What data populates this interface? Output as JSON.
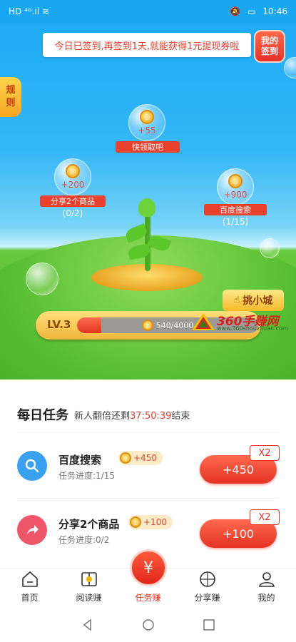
{
  "status_bar": {
    "left": "HD ⁴ᴳ.ıl ≋",
    "time": "10:46"
  },
  "hero": {
    "sign_banner": "今日已签到,再签到1天,就能获得1元提现券啦",
    "my_signin_line1": "我的",
    "my_signin_line2": "签到",
    "rules_line1": "规",
    "rules_line2": "则",
    "bubbles": [
      {
        "value": "+55",
        "label": "快领取吧",
        "progress": ""
      },
      {
        "value": "+200",
        "label": "分享2个商品",
        "progress": "(0/2)"
      },
      {
        "value": "+900",
        "label": "百度搜索",
        "progress": "(1/15)"
      }
    ],
    "mall_label": "挑小城",
    "watermark_title": "360手赚网",
    "watermark_url": "www.360shouzhuan.com"
  },
  "level": {
    "label": "LV.3",
    "current": 540,
    "max": 4000,
    "text": "540/4000"
  },
  "tasks": {
    "title": "每日任务",
    "subtitle_prefix": "新人翻倍还剩",
    "countdown": "37:50:39",
    "subtitle_suffix": "结束",
    "items": [
      {
        "name": "百度搜索",
        "reward": "+450",
        "progress": "任务进度:1/15",
        "button": "+450",
        "multiplier": "X2",
        "icon": "search-icon",
        "color": "#3aa0f0"
      },
      {
        "name": "分享2个商品",
        "reward": "+100",
        "progress": "任务进度:0/2",
        "button": "+100",
        "multiplier": "X2",
        "icon": "share-arrow-icon",
        "color": "#f0566a"
      }
    ]
  },
  "nav": {
    "items": [
      {
        "label": "首页",
        "icon": "home-icon"
      },
      {
        "label": "阅读赚",
        "icon": "book-icon"
      },
      {
        "label": "任务赚",
        "icon": "yuan-icon"
      },
      {
        "label": "分享赚",
        "icon": "share-icon"
      },
      {
        "label": "我的",
        "icon": "user-icon"
      }
    ],
    "center_symbol": "¥"
  },
  "colors": {
    "accent": "#e53222",
    "sky": "#1aa9f3",
    "grass": "#58bf33"
  }
}
